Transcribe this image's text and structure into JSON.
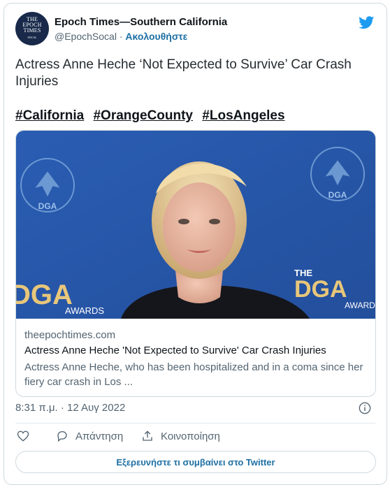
{
  "account": {
    "avatar_lines": [
      "THE",
      "EPOCH",
      "TIMES",
      "SOCAL"
    ],
    "name": "Epoch Times—Southern California",
    "handle": "@EpochSocal",
    "separator": "·",
    "follow_label": "Ακολουθήστε"
  },
  "tweet": {
    "text": "Actress Anne Heche ‘Not Expected to Survive’ Car Crash Injuries",
    "hashtags": [
      "#California",
      "#OrangeCounty",
      "#LosAngeles"
    ],
    "timestamp": "8:31 π.μ. · 12 Αυγ 2022"
  },
  "link_card": {
    "photo_text": {
      "guild_left": "DIRECTORS GUILD OF AMERICA",
      "guild_right": "DIRECTORS GUILD OF AMERICA",
      "dga": "DGA",
      "the": "THE",
      "awards": "AWARDS"
    },
    "domain": "theepochtimes.com",
    "title": "Actress Anne Heche 'Not Expected to Survive' Car Crash Injuries",
    "description": "Actress Anne Heche, who has been hospitalized and in a coma since her fiery car crash in Los ..."
  },
  "actions": {
    "reply_label": "Απάντηση",
    "share_label": "Κοινοποίηση",
    "explore_label": "Εξερευνήστε τι συμβαίνει στο Twitter"
  },
  "colors": {
    "accent": "#1d9bf0",
    "link": "#1d6fa3",
    "backdrop": "#2b5cae",
    "dga_gold": "#e8c77a"
  },
  "icons": [
    "twitter-bird-icon",
    "info-icon",
    "heart-icon",
    "reply-icon",
    "share-icon"
  ]
}
